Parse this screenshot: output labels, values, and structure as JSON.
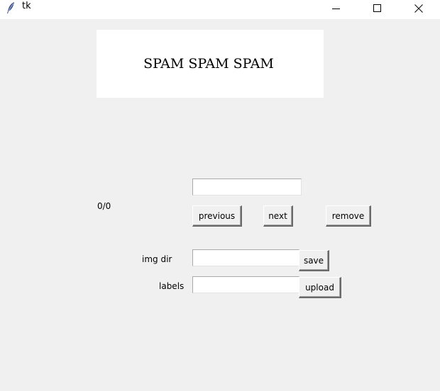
{
  "window": {
    "title": "tk",
    "icon": "feather-icon",
    "controls": {
      "minimize_icon": "minimize-icon",
      "maximize_icon": "maximize-icon",
      "close_icon": "close-icon"
    }
  },
  "banner": {
    "text": "SPAM SPAM SPAM"
  },
  "navigation": {
    "counter": "0/0",
    "top_input_value": "",
    "previous_label": "previous",
    "next_label": "next",
    "remove_label": "remove"
  },
  "form": {
    "img_dir_label": "img dir",
    "img_dir_value": "",
    "save_label": "save",
    "labels_label": "labels",
    "labels_value": "",
    "upload_label": "upload"
  }
}
